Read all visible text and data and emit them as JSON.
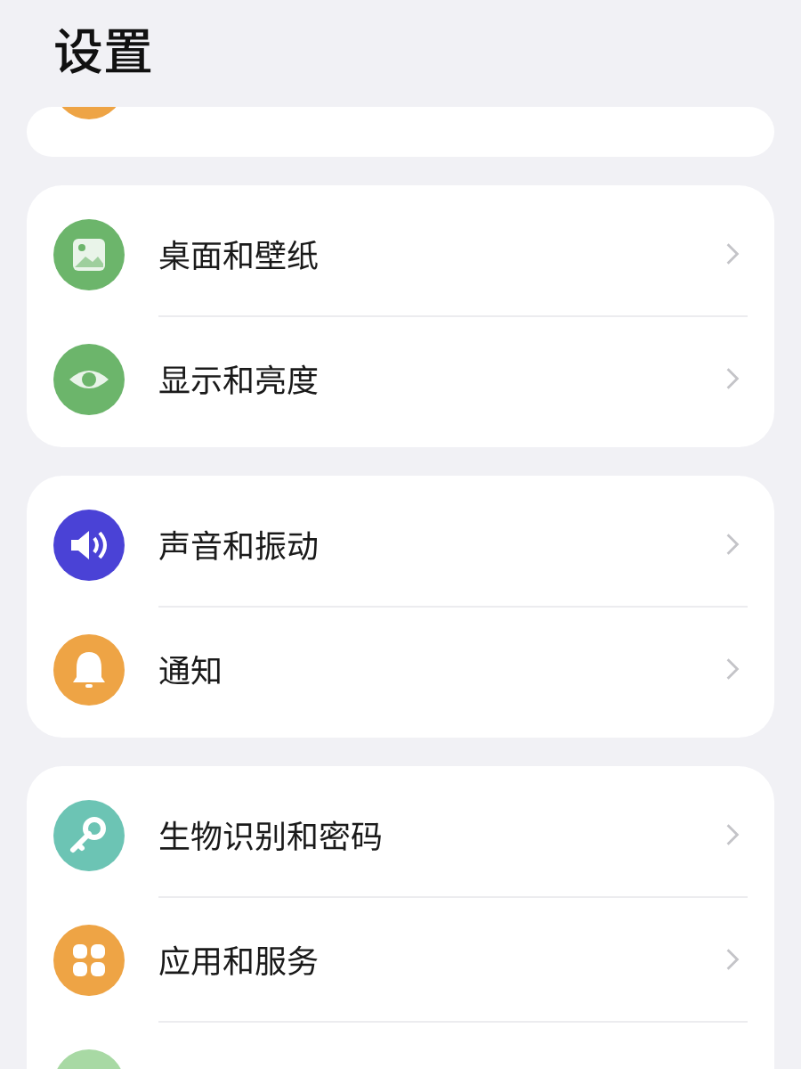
{
  "title": "设置",
  "groups": [
    {
      "items": [
        {
          "color": "#eea445"
        }
      ]
    },
    {
      "items": [
        {
          "label": "桌面和壁纸",
          "color": "#6cb56b"
        },
        {
          "label": "显示和亮度",
          "color": "#6cb56b"
        }
      ]
    },
    {
      "items": [
        {
          "label": "声音和振动",
          "color": "#4a42d6"
        },
        {
          "label": "通知",
          "color": "#eea445"
        }
      ]
    },
    {
      "items": [
        {
          "label": "生物识别和密码",
          "color": "#6cc4b4"
        },
        {
          "label": "应用和服务",
          "color": "#eea445"
        },
        {
          "color": "#a8d9a4"
        }
      ]
    }
  ]
}
